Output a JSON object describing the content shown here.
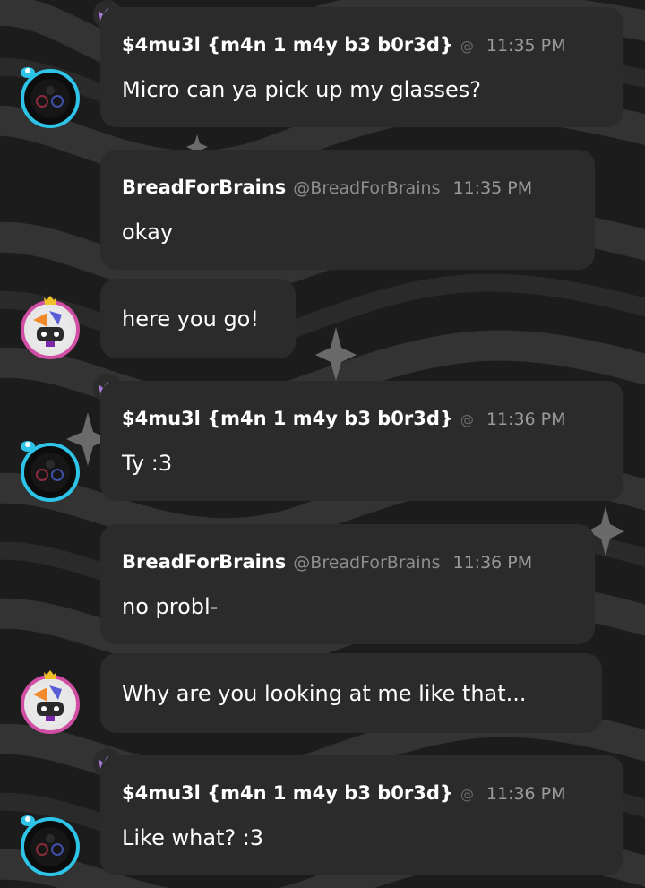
{
  "messages": [
    {
      "type": "full",
      "user": "$4mu3l {m4n 1 m4y b3 b0r3d}",
      "handle": "",
      "at": "@",
      "time": "11:35 PM",
      "text": "Micro can ya pick up my glasses?"
    },
    {
      "type": "full",
      "user": "BreadForBrains",
      "handle": "@BreadForBrains",
      "at": "",
      "time": "11:35 PM",
      "text": "okay"
    },
    {
      "type": "continuation",
      "text": "here you go!"
    },
    {
      "type": "full",
      "user": "$4mu3l {m4n 1 m4y b3 b0r3d}",
      "handle": "",
      "at": "@",
      "time": "11:36 PM",
      "text": "Ty :3"
    },
    {
      "type": "full",
      "user": "BreadForBrains",
      "handle": "@BreadForBrains",
      "at": "",
      "time": "11:36 PM",
      "text": "no probl-"
    },
    {
      "type": "continuation",
      "text": "Why are you looking at me like that..."
    },
    {
      "type": "full",
      "user": "$4mu3l {m4n 1 m4y b3 b0r3d}",
      "handle": "",
      "at": "@",
      "time": "11:36 PM",
      "text": "Like what? :3"
    }
  ],
  "icons": {
    "crown": "crown-icon",
    "avatar_samuel": "avatar-samuel",
    "avatar_bread": "avatar-breadforbrains"
  },
  "colors": {
    "bubble": "#2b2b2b",
    "crown": "#a77ad8",
    "avatar_ring_samuel": "#2ec4e8",
    "avatar_ring_bread": "#d04ea3"
  }
}
